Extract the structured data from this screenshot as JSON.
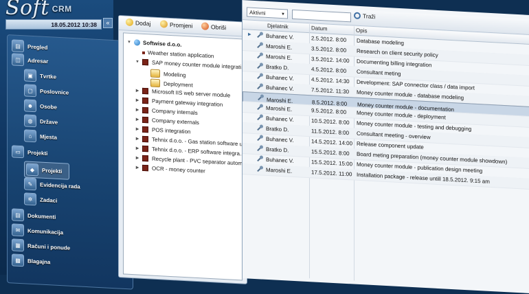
{
  "app": {
    "logo_main": "Soft",
    "logo_sub": "CRM",
    "datetime": "18.05.2012 10:38",
    "collapse": "«"
  },
  "nav": [
    {
      "label": "Pregled",
      "icon": "dashboard-icon",
      "glyph": "▤",
      "level": 0
    },
    {
      "label": "Adresar",
      "icon": "address-book-icon",
      "glyph": "◫",
      "level": 0
    },
    {
      "label": "Tvrtke",
      "icon": "company-icon",
      "glyph": "▣",
      "level": 1
    },
    {
      "label": "Poslovnice",
      "icon": "branch-icon",
      "glyph": "▢",
      "level": 1
    },
    {
      "label": "Osobe",
      "icon": "people-icon",
      "glyph": "☻",
      "level": 1
    },
    {
      "label": "Države",
      "icon": "globe-icon",
      "glyph": "◍",
      "level": 1
    },
    {
      "label": "Mjesta",
      "icon": "location-icon",
      "glyph": "⌂",
      "level": 1
    },
    {
      "label": "Projekti",
      "icon": "folder-icon",
      "glyph": "▭",
      "level": 0
    },
    {
      "label": "Projekti",
      "icon": "project-icon",
      "glyph": "◆",
      "level": 1,
      "active": true
    },
    {
      "label": "Evidencija rada",
      "icon": "wrench-icon",
      "glyph": "✎",
      "level": 1
    },
    {
      "label": "Zadaci",
      "icon": "gear-icon",
      "glyph": "✲",
      "level": 1
    },
    {
      "label": "Dokumenti",
      "icon": "document-icon",
      "glyph": "▤",
      "level": 0
    },
    {
      "label": "Komunikacija",
      "icon": "communication-icon",
      "glyph": "✉",
      "level": 0
    },
    {
      "label": "Računi i ponude",
      "icon": "invoice-icon",
      "glyph": "▦",
      "level": 0
    },
    {
      "label": "Blagajna",
      "icon": "cashbox-icon",
      "glyph": "▩",
      "level": 0
    }
  ],
  "tree_toolbar": {
    "add": "Dodaj",
    "edit": "Promjeni",
    "delete": "Obriši"
  },
  "tree": [
    {
      "label": "Softwise d.o.o.",
      "type": "root",
      "depth": 0,
      "arrow": "▼"
    },
    {
      "label": "Weather station application",
      "type": "dot",
      "depth": 1,
      "arrow": ""
    },
    {
      "label": "SAP money counter module integrati...",
      "type": "node",
      "depth": 1,
      "arrow": "▼"
    },
    {
      "label": "Modeling",
      "type": "box",
      "depth": 2,
      "arrow": ""
    },
    {
      "label": "Deployment",
      "type": "box",
      "depth": 2,
      "arrow": ""
    },
    {
      "label": "Microsoft IIS web server module",
      "type": "node",
      "depth": 1,
      "arrow": "▶"
    },
    {
      "label": "Payment gateway integration",
      "type": "node",
      "depth": 1,
      "arrow": "▶"
    },
    {
      "label": "Company internals",
      "type": "node",
      "depth": 1,
      "arrow": "▶"
    },
    {
      "label": "Company externals",
      "type": "node",
      "depth": 1,
      "arrow": "▶"
    },
    {
      "label": "POS integration",
      "type": "node",
      "depth": 1,
      "arrow": "▶"
    },
    {
      "label": "Tehnix d.o.o. - Gas station software u...",
      "type": "node",
      "depth": 1,
      "arrow": "▶"
    },
    {
      "label": "Tehnix d.o.o. - ERP software integra...",
      "type": "node",
      "depth": 1,
      "arrow": "▶"
    },
    {
      "label": "Recycle plant - PVC separator autom...",
      "type": "node",
      "depth": 1,
      "arrow": "▶"
    },
    {
      "label": "OCR - money counter",
      "type": "node",
      "depth": 1,
      "arrow": "▶"
    }
  ],
  "grid_toolbar": {
    "filter_value": "Aktivni",
    "search_placeholder": "",
    "search_button": "Traži"
  },
  "grid": {
    "columns": [
      "Djelatnik",
      "Datum",
      "Opis"
    ],
    "rows": [
      {
        "worker": "Buhanec V.",
        "date": "2.5.2012. 8:00",
        "desc": "Database modeling",
        "current": true
      },
      {
        "worker": "Maroshi E.",
        "date": "3.5.2012. 8:00",
        "desc": "Research on client security policy"
      },
      {
        "worker": "Maroshi E.",
        "date": "3.5.2012. 14:00",
        "desc": "Documenting billing integration"
      },
      {
        "worker": "Bratko D.",
        "date": "4.5.2012. 8:00",
        "desc": "Consultant meting"
      },
      {
        "worker": "Buhanec V.",
        "date": "4.5.2012. 14:30",
        "desc": "Development: SAP connector class / data import"
      },
      {
        "worker": "Buhanec V.",
        "date": "7.5.2012. 11:30",
        "desc": "Money counter module - database modeling"
      },
      {
        "worker": "Maroshi E.",
        "date": "8.5.2012. 8:00",
        "desc": "Money counter module - documentation",
        "selected": true
      },
      {
        "worker": "Maroshi E.",
        "date": "9.5.2012. 8:00",
        "desc": "Money counter module  - deployment"
      },
      {
        "worker": "Buhanec V.",
        "date": "10.5.2012. 8:00",
        "desc": "Money counter module - testing and debugging"
      },
      {
        "worker": "Bratko D.",
        "date": "11.5.2012. 8:00",
        "desc": "Consultant meeting - overview"
      },
      {
        "worker": "Buhanec V.",
        "date": "14.5.2012. 14:00",
        "desc": "Release component update"
      },
      {
        "worker": "Bratko D.",
        "date": "15.5.2012. 8:00",
        "desc": "Board meting preparation (money counter module showdown)"
      },
      {
        "worker": "Buhanec V.",
        "date": "15.5.2012. 15:00",
        "desc": "Money counter module - publication design meeting"
      },
      {
        "worker": "Maroshi E.",
        "date": "17.5.2012. 11:00",
        "desc": "Installation package - release untill 18.5.2012. 9:15 am"
      }
    ]
  }
}
